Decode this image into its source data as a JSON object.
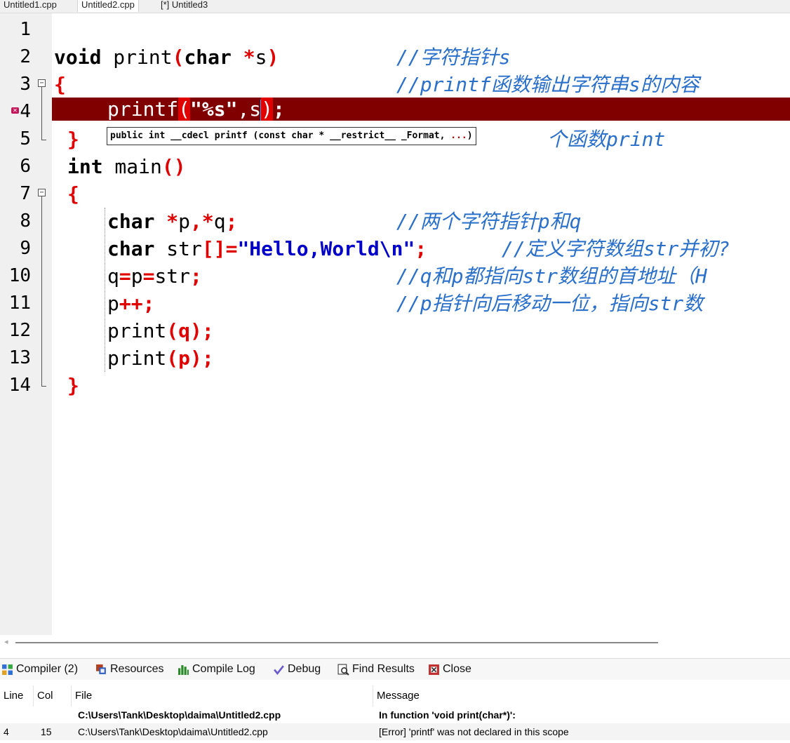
{
  "tabs": [
    {
      "label": "Untitled1.cpp",
      "active": false
    },
    {
      "label": "Untitled2.cpp",
      "active": true
    },
    {
      "label": "[*] Untitled3",
      "active": false
    }
  ],
  "editor": {
    "line_numbers": [
      "1",
      "2",
      "3",
      "4",
      "5",
      "6",
      "7",
      "8",
      "9",
      "10",
      "11",
      "12",
      "13",
      "14"
    ],
    "error_line": 4,
    "lines": {
      "l2_void": "void",
      "l2_print": " print",
      "l2_paren_open": "(",
      "l2_char": "char",
      "l2_star": " *",
      "l2_s": "s",
      "l2_paren_close": ")",
      "l3_brace": "{",
      "l4_printf": "printf",
      "l4_po": "(",
      "l4_str": "\"%s\"",
      "l4_comma": ",s",
      "l4_pc": ")",
      "l4_semi": ";",
      "l5_brace": "}",
      "l6_int": "int",
      "l6_main": " main",
      "l6_parens": "()",
      "l7_brace": "{",
      "l8_char": "char",
      "l8_rest1": " ",
      "l8_star1": "*",
      "l8_p": "p",
      "l8_comma": ",",
      "l8_star2": "*",
      "l8_q": "q",
      "l8_semi": ";",
      "l9_char": "char",
      "l9_str": " str",
      "l9_brackets": "[]=",
      "l9_literal": "\"Hello,World\\n\"",
      "l9_semi": ";",
      "l10_q": "q",
      "l10_eq1": "=",
      "l10_p": "p",
      "l10_eq2": "=",
      "l10_str": "str",
      "l10_semi": ";",
      "l11_p": "p",
      "l11_pp": "++",
      "l11_semi": ";",
      "l12_print": "print",
      "l12_args": "(q);",
      "l13_print": "print",
      "l13_args": "(p);",
      "l14_brace": "}"
    },
    "comments": {
      "l2": "//字符指针s",
      "l3": "//printf函数输出字符串s的内容",
      "l5": "个函数print",
      "l8": "//两个字符指针p和q",
      "l9": "//定义字符数组str并初?",
      "l10": "//q和p都指向str数组的首地址（H",
      "l11": "//p指针向后移动一位，指向str数"
    },
    "tooltip": {
      "prefix": "public int __cdecl printf (const char * __restrict__ _Format, ",
      "emphasis": "...",
      "suffix": ")"
    }
  },
  "bottom_panel": {
    "tabs": [
      {
        "label": "Compiler (2)",
        "icon": "grid-icon"
      },
      {
        "label": "Resources",
        "icon": "resources-icon"
      },
      {
        "label": "Compile Log",
        "icon": "bar-chart-icon"
      },
      {
        "label": "Debug",
        "icon": "check-icon"
      },
      {
        "label": "Find Results",
        "icon": "magnifier-icon"
      },
      {
        "label": "Close",
        "icon": "close-panel-icon"
      }
    ],
    "columns": [
      "Line",
      "Col",
      "File",
      "Message"
    ],
    "rows": [
      {
        "line": "",
        "col": "",
        "file": "C:\\Users\\Tank\\Desktop\\daima\\Untitled2.cpp",
        "message": "In function 'void print(char*)':",
        "bold": true
      },
      {
        "line": "4",
        "col": "15",
        "file": "C:\\Users\\Tank\\Desktop\\daima\\Untitled2.cpp",
        "message": "[Error] 'printf' was not declared in this scope",
        "bold": false
      }
    ]
  },
  "colors": {
    "error_row": "#800000",
    "comment": "#2a6fc9",
    "operator": "#e00000",
    "string": "#0000c8"
  }
}
